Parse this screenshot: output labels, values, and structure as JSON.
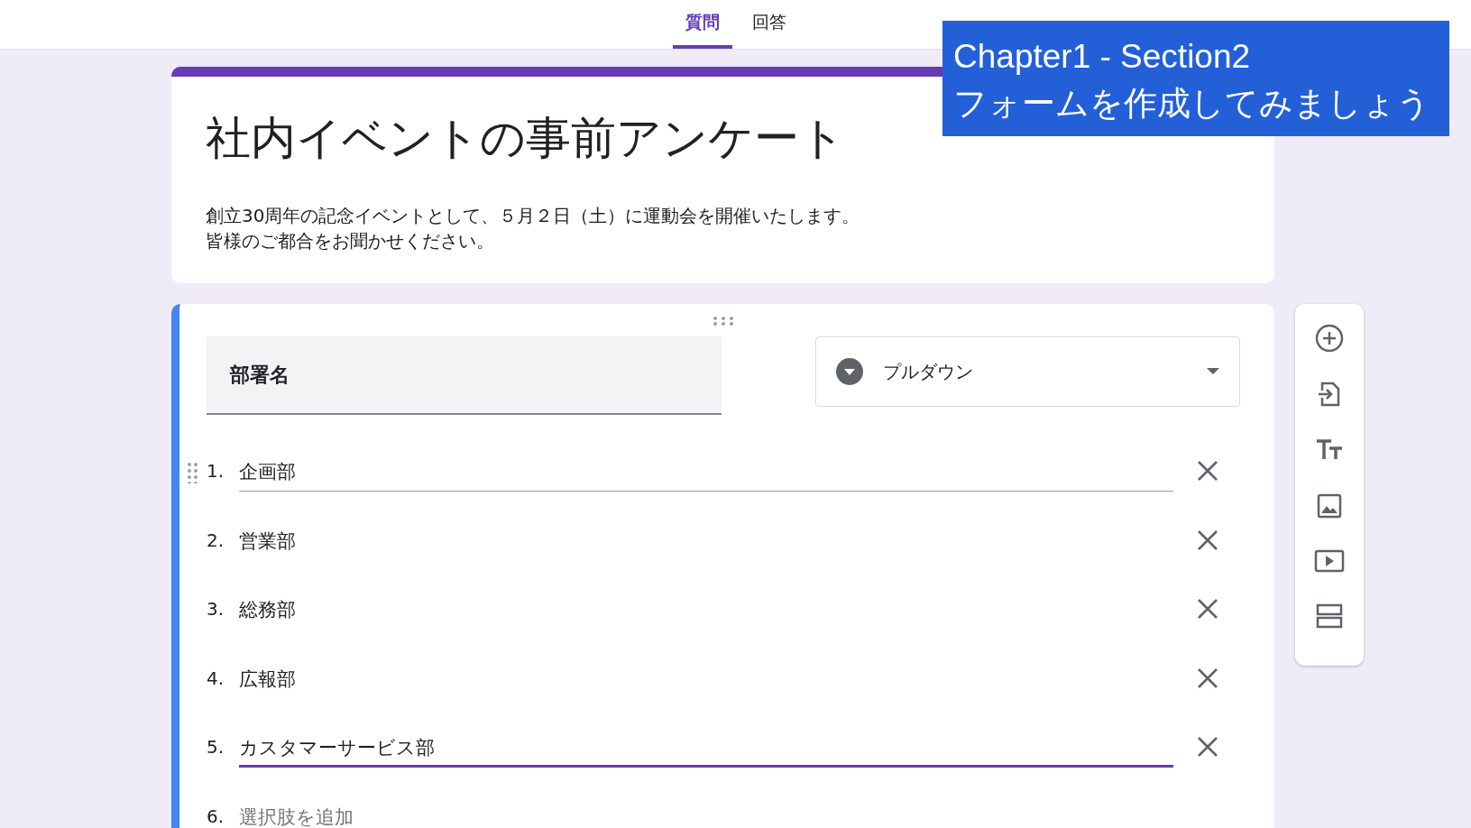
{
  "tabs": [
    {
      "label": "質問",
      "selected": true
    },
    {
      "label": "回答",
      "selected": false
    }
  ],
  "overlay": {
    "lines": [
      "Chapter1 - Section2",
      "フォームを作成してみましょう"
    ]
  },
  "header": {
    "title": "社内イベントの事前アンケート",
    "description": [
      "創立30周年の記念イベントとして、５月２日（土）に運動会を開催いたします。",
      "皆様のご都合をお聞かせください。"
    ]
  },
  "question": {
    "title": "部署名",
    "type": "プルダウン",
    "options": [
      {
        "number": "1.",
        "text": "企画部",
        "hovered": true,
        "focused": false
      },
      {
        "number": "2.",
        "text": "営業部",
        "hovered": false,
        "focused": false
      },
      {
        "number": "3.",
        "text": "総務部",
        "hovered": false,
        "focused": false
      },
      {
        "number": "4.",
        "text": "広報部",
        "hovered": false,
        "focused": false
      },
      {
        "number": "5.",
        "text": "カスタマーサービス部",
        "hovered": false,
        "focused": true
      }
    ],
    "add_option": {
      "number": "6.",
      "placeholder": "選択肢を追加"
    }
  }
}
